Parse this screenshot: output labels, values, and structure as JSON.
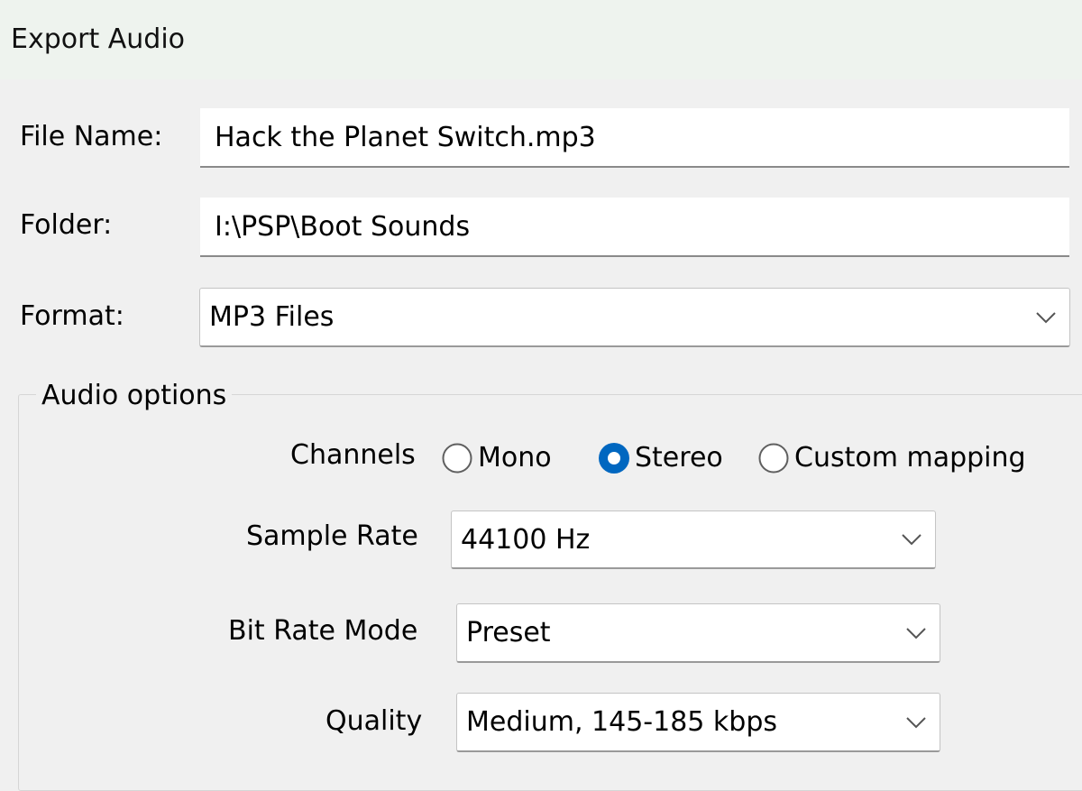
{
  "window": {
    "title": "Export Audio"
  },
  "form": {
    "file_name_label": "File Name:",
    "file_name_value": "Hack the Planet Switch.mp3",
    "folder_label": "Folder:",
    "folder_value": "I:\\PSP\\Boot Sounds",
    "format_label": "Format:",
    "format_value": "MP3 Files"
  },
  "audio_options": {
    "title": "Audio options",
    "channels_label": "Channels",
    "channels": [
      {
        "label": "Mono",
        "selected": false
      },
      {
        "label": "Stereo",
        "selected": true
      },
      {
        "label": "Custom mapping",
        "selected": false
      }
    ],
    "sample_rate_label": "Sample Rate",
    "sample_rate_value": "44100 Hz",
    "bit_rate_mode_label": "Bit Rate Mode",
    "bit_rate_mode_value": "Preset",
    "quality_label": "Quality",
    "quality_value": "Medium, 145-185 kbps"
  },
  "colors": {
    "accent": "#0067c0",
    "titlebar": "#eef3ee",
    "background": "#f0f0f0"
  },
  "icons": {
    "dropdown": "chevron-down-icon",
    "radio_selected": "radio-selected-icon",
    "radio_unselected": "radio-unselected-icon"
  }
}
